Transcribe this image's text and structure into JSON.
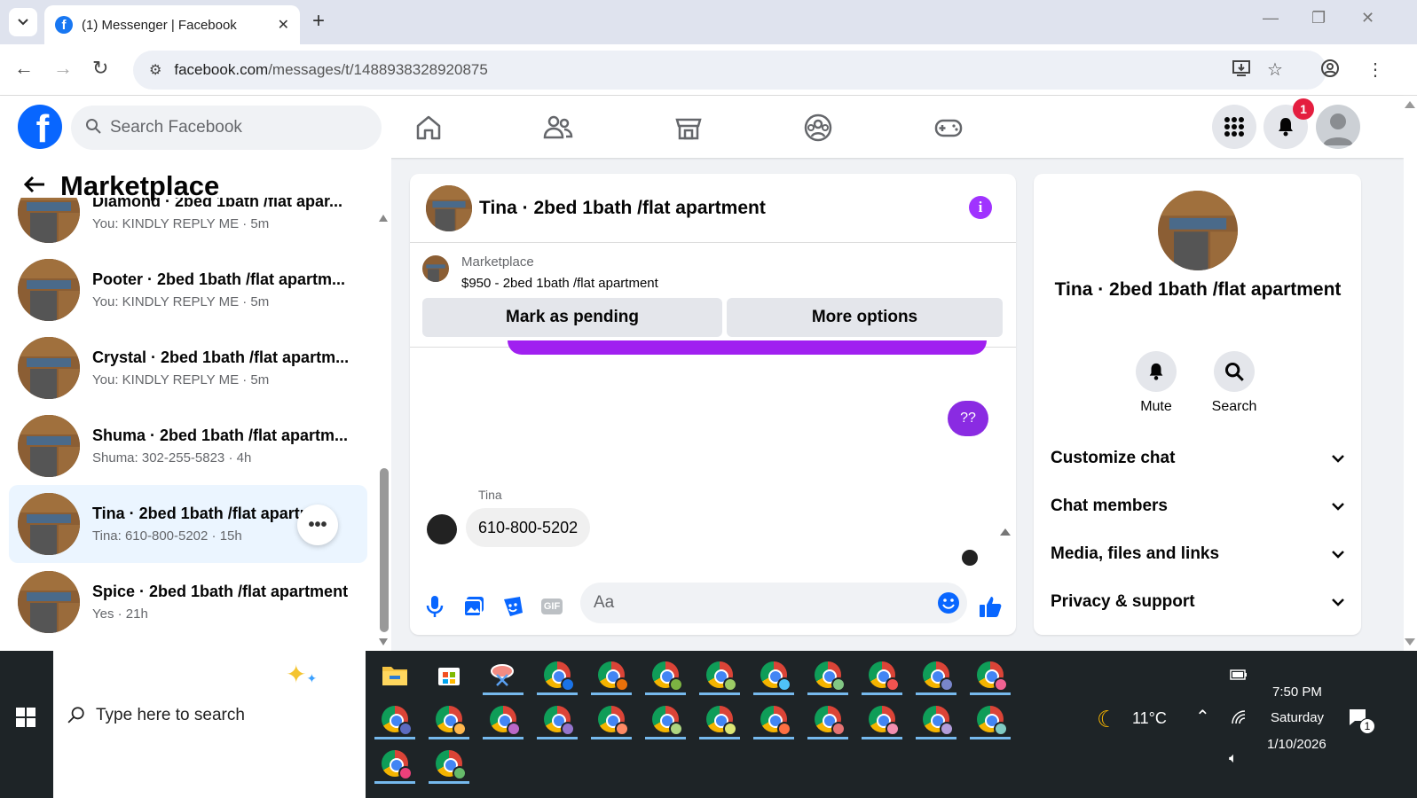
{
  "browser": {
    "tab_title": "(1) Messenger | Facebook",
    "url_host": "facebook.com",
    "url_path": "/messages/t/1488938328920875"
  },
  "fb_header": {
    "search_placeholder": "Search Facebook",
    "notifications_count": "1"
  },
  "left": {
    "title": "Marketplace",
    "chats": [
      {
        "name": "Diamond · 2bed 1bath /flat apar...",
        "preview": "You: KINDLY REPLY ME · 5m"
      },
      {
        "name": "Pooter · 2bed 1bath /flat apartm...",
        "preview": "You: KINDLY REPLY ME · 5m"
      },
      {
        "name": "Crystal · 2bed 1bath /flat apartm...",
        "preview": "You: KINDLY REPLY ME · 5m"
      },
      {
        "name": "Shuma · 2bed 1bath /flat apartm...",
        "preview": "Shuma: 302-255-5823 · 4h"
      },
      {
        "name": "Tina · 2bed 1bath /flat apartm...",
        "preview": "Tina: 610-800-5202 · 15h"
      },
      {
        "name": "Spice · 2bed 1bath /flat apartment",
        "preview": "Yes · 21h"
      }
    ]
  },
  "conversation": {
    "title": "Tina · 2bed 1bath /flat apartment",
    "marketplace_label": "Marketplace",
    "listing": "$950 - 2bed 1bath /flat apartment",
    "mark_pending_label": "Mark as pending",
    "more_options_label": "More options",
    "outgoing_message": "??",
    "sender_name": "Tina",
    "incoming_message": "610-800-5202",
    "composer_placeholder": "Aa",
    "gif_label": "GIF"
  },
  "info_panel": {
    "name": "Tina · 2bed 1bath /flat apartment",
    "mute_label": "Mute",
    "search_label": "Search",
    "sections": [
      "Customize chat",
      "Chat members",
      "Media, files and links",
      "Privacy & support"
    ]
  },
  "taskbar": {
    "search_placeholder": "Type here to search",
    "weather": "11°C",
    "time": "7:50 PM",
    "day": "Saturday",
    "date": "1/10/2026",
    "notification_count": "1"
  },
  "colors": {
    "fb_blue": "#0866ff",
    "messenger_purple": "#a033ff",
    "notif_red": "#e41e3f"
  }
}
